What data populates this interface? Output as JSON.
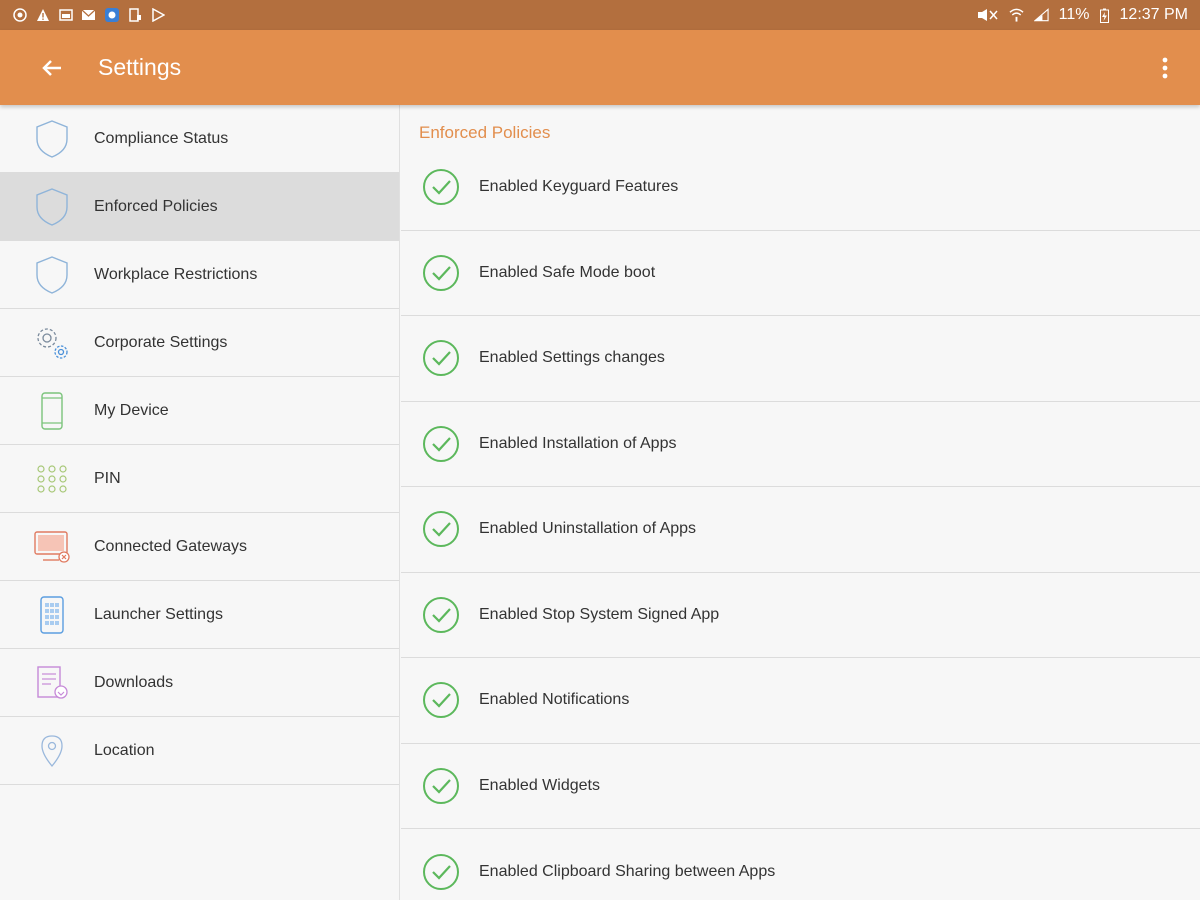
{
  "status_bar": {
    "battery": "11%",
    "time": "12:37 PM"
  },
  "app_bar": {
    "title": "Settings"
  },
  "colors": {
    "status_bar": "#b36f3e",
    "app_bar": "#e28e4d",
    "accent": "#e28e4d",
    "check": "#5cb85c"
  },
  "sidebar": {
    "items": [
      {
        "label": "Compliance Status",
        "icon": "shield-icon"
      },
      {
        "label": "Enforced Policies",
        "icon": "shield-icon"
      },
      {
        "label": "Workplace Restrictions",
        "icon": "shield-icon"
      },
      {
        "label": "Corporate Settings",
        "icon": "gears-icon"
      },
      {
        "label": "My Device",
        "icon": "phone-icon"
      },
      {
        "label": "PIN",
        "icon": "keypad-icon"
      },
      {
        "label": "Connected Gateways",
        "icon": "monitor-icon"
      },
      {
        "label": "Launcher Settings",
        "icon": "launcher-icon"
      },
      {
        "label": "Downloads",
        "icon": "document-icon"
      },
      {
        "label": "Location",
        "icon": "location-pin-icon"
      }
    ]
  },
  "main": {
    "section_title": "Enforced Policies",
    "policies": [
      "Enabled Keyguard Features",
      "Enabled Safe Mode boot",
      "Enabled Settings changes",
      "Enabled Installation of Apps",
      "Enabled Uninstallation of Apps",
      "Enabled Stop System Signed App",
      "Enabled Notifications",
      "Enabled Widgets",
      "Enabled Clipboard Sharing between Apps"
    ]
  }
}
